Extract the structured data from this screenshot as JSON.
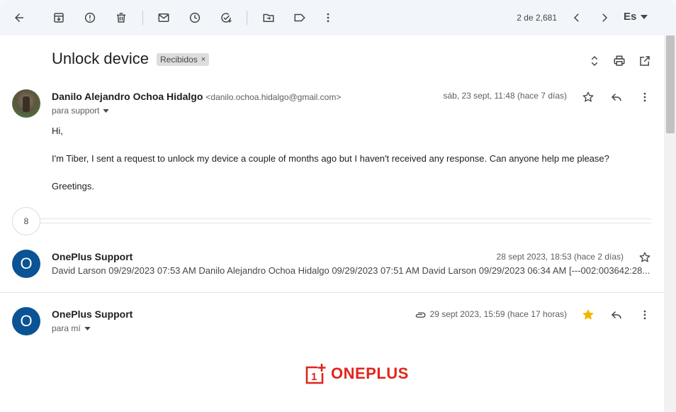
{
  "toolbar": {
    "pager_text": "2 de 2,681",
    "language": "Es"
  },
  "thread": {
    "subject": "Unlock device",
    "label": "Recibidos",
    "label_remove": "×"
  },
  "messages": [
    {
      "sender": "Danilo Alejandro Ochoa Hidalgo",
      "email": "<danilo.ochoa.hidalgo@gmail.com>",
      "to": "para support",
      "date": "sáb, 23 sept, 11:48 (hace 7 días)",
      "body": [
        "Hi,",
        "I'm Tiber, I sent a request to unlock my device a couple of months ago but I haven't received any response. Can anyone help me please?",
        "Greetings."
      ]
    },
    {
      "avatar": "O",
      "sender": "OnePlus Support",
      "date": "28 sept 2023, 18:53 (hace 2 días)",
      "snippet": "David Larson 09/29/2023 07:53 AM Danilo Alejandro Ochoa Hidalgo 09/29/2023 07:51 AM David Larson 09/29/2023 06:34 AM [---002:003642:28..."
    },
    {
      "avatar": "O",
      "sender": "OnePlus Support",
      "to": "para mí",
      "date": "29 sept 2023, 15:59 (hace 17 horas)",
      "starred": true
    }
  ],
  "collapsed_count": "8",
  "logo": {
    "text": "ONEPLUS",
    "mark_digit": "1"
  },
  "colors": {
    "accent_blue": "#0b5394",
    "brand_red": "#e1251b",
    "star_gold": "#f4b400"
  }
}
